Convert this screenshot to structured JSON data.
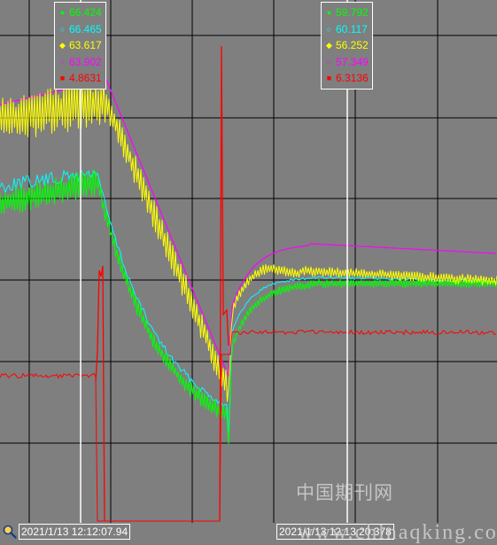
{
  "colors": {
    "background": "#7f7f7f",
    "grid": "#000000",
    "cursor": "#ffffff",
    "series": [
      "#00ff00",
      "#00ffff",
      "#ffff00",
      "#ff00ff",
      "#ff0000"
    ]
  },
  "cursors": [
    {
      "readings": [
        {
          "marker": "●",
          "color": "#00ff00",
          "value": "66.424"
        },
        {
          "marker": "○",
          "color": "#00ffff",
          "value": "66.465"
        },
        {
          "marker": "◆",
          "color": "#ffff00",
          "value": "63.617"
        },
        {
          "marker": "○",
          "color": "#ff00ff",
          "value": "63.902"
        },
        {
          "marker": "■",
          "color": "#ff0000",
          "value": "4.8631"
        }
      ],
      "time": "2021/1/13 12:12:07.94"
    },
    {
      "readings": [
        {
          "marker": "●",
          "color": "#00ff00",
          "value": "59.792"
        },
        {
          "marker": "○",
          "color": "#00ffff",
          "value": "60.117"
        },
        {
          "marker": "◆",
          "color": "#ffff00",
          "value": "56.252"
        },
        {
          "marker": "○",
          "color": "#ff00ff",
          "value": "57.349"
        },
        {
          "marker": "■",
          "color": "#ff0000",
          "value": "6.3136"
        }
      ],
      "time": "2021/1/13 12:13:20.378"
    }
  ],
  "watermark": {
    "cn": "中国期刊网",
    "url": "www.chinaqking.com"
  },
  "toolbar": {
    "zoom_icon": "zoom-icon"
  }
}
